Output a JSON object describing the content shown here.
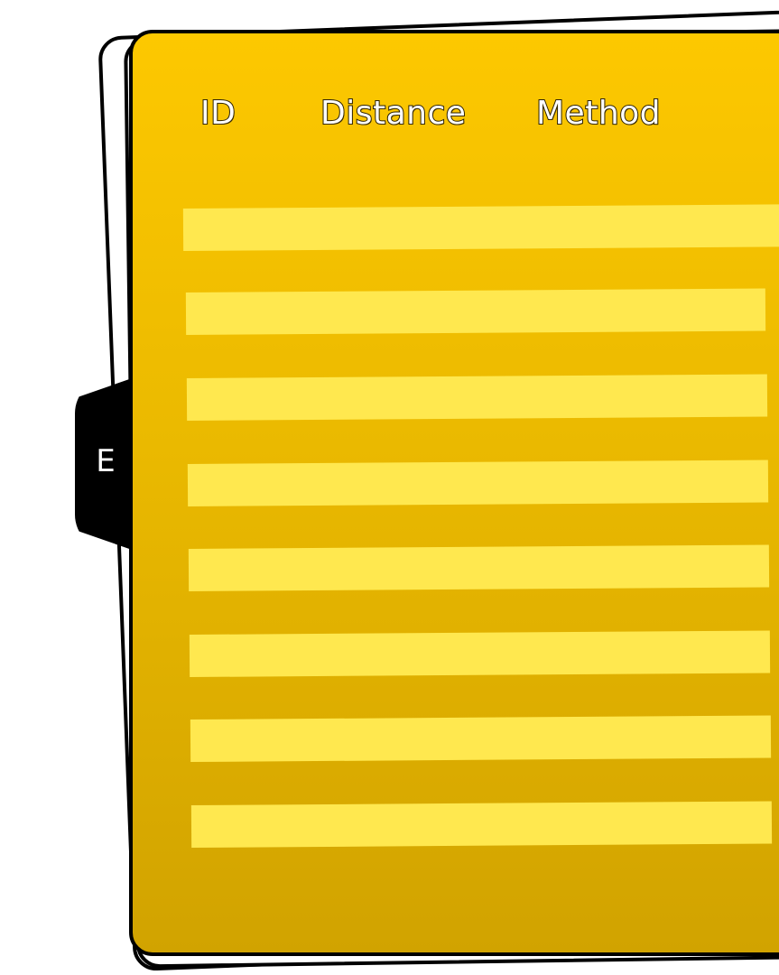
{
  "tab": {
    "label": "E"
  },
  "table": {
    "headers": [
      "ID",
      "Distance",
      "Method"
    ],
    "rows": [
      {
        "id": "",
        "distance": "",
        "method": ""
      },
      {
        "id": "",
        "distance": "",
        "method": ""
      },
      {
        "id": "",
        "distance": "",
        "method": ""
      },
      {
        "id": "",
        "distance": "",
        "method": ""
      },
      {
        "id": "",
        "distance": "",
        "method": ""
      },
      {
        "id": "",
        "distance": "",
        "method": ""
      },
      {
        "id": "",
        "distance": "",
        "method": ""
      },
      {
        "id": "",
        "distance": "",
        "method": ""
      }
    ]
  },
  "colors": {
    "card_top": "#fdc800",
    "card_bottom": "#d1a300",
    "row_fill": "#ffe84f",
    "border": "#000000",
    "header_text": "#ffffff",
    "tab_fill": "#000000"
  }
}
